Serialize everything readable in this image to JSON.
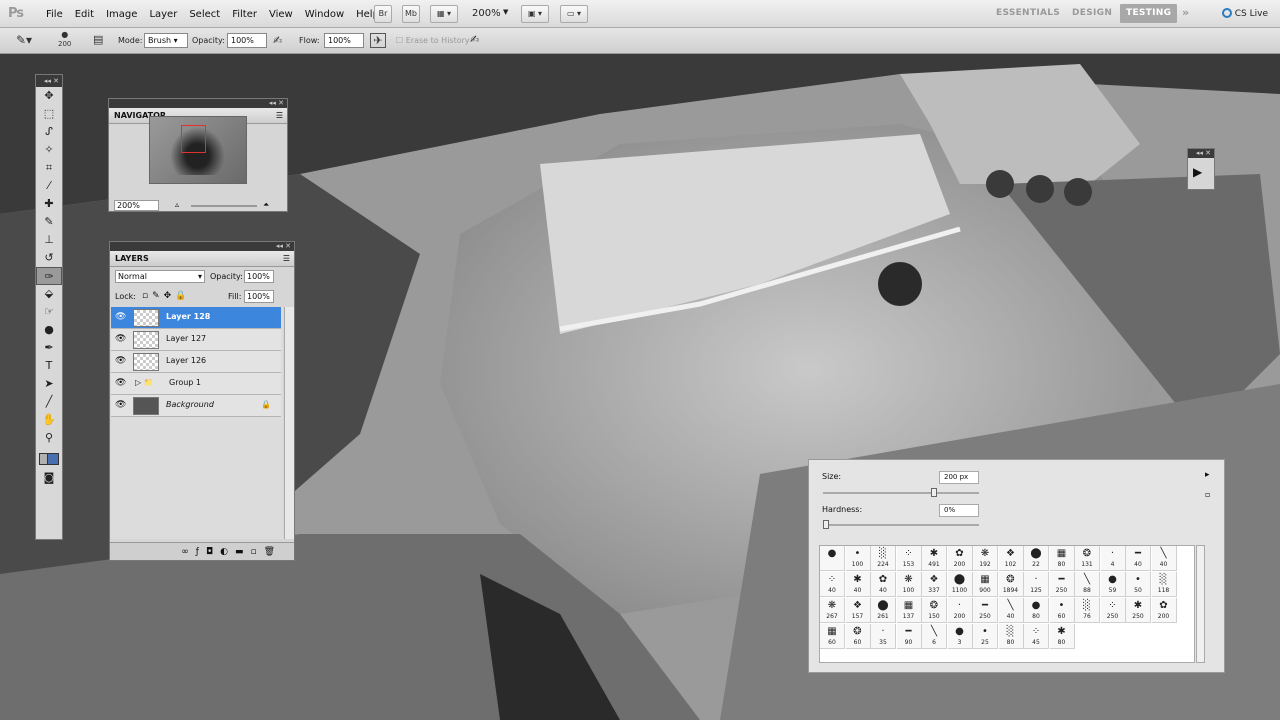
{
  "app": {
    "logo": "Ps"
  },
  "menubar": {
    "items": [
      "File",
      "Edit",
      "Image",
      "Layer",
      "Select",
      "Filter",
      "View",
      "Window",
      "Help"
    ],
    "bridge_btn": "Br",
    "minibridge_btn": "Mb",
    "zoom": "200%",
    "workspaces": [
      "ESSENTIALS",
      "DESIGN",
      "TESTING"
    ],
    "active_workspace": "TESTING",
    "cs_live": "CS Live"
  },
  "options": {
    "brush_size": "200",
    "mode_label": "Mode:",
    "mode_value": "Brush",
    "opacity_label": "Opacity:",
    "opacity_value": "100%",
    "flow_label": "Flow:",
    "flow_value": "100%",
    "erase_history": "Erase to History"
  },
  "navigator": {
    "title": "NAVIGATOR",
    "zoom": "200%"
  },
  "layers": {
    "title": "LAYERS",
    "blend_mode": "Normal",
    "opacity_label": "Opacity:",
    "opacity_value": "100%",
    "lock_label": "Lock:",
    "fill_label": "Fill:",
    "fill_value": "100%",
    "rows": [
      {
        "name": "Layer 128",
        "selected": true
      },
      {
        "name": "Layer 127"
      },
      {
        "name": "Layer 126"
      },
      {
        "name": "Group 1",
        "group": true
      },
      {
        "name": "Background",
        "locked": true
      }
    ]
  },
  "brush_picker": {
    "size_label": "Size:",
    "size_value": "200 px",
    "hardness_label": "Hardness:",
    "hardness_value": "0%",
    "size_fraction": 0.72,
    "hardness_fraction": 0.0,
    "brushes": [
      [
        "",
        "100",
        "224",
        "153",
        "491",
        "200",
        "192",
        "102",
        "22",
        "80",
        "131",
        "4",
        "40",
        "40"
      ],
      [
        "40",
        "40",
        "40",
        "100",
        "337",
        "1100",
        "900",
        "1894",
        "125",
        "250",
        "88",
        "59",
        "50",
        "118"
      ],
      [
        "267",
        "157",
        "261",
        "137",
        "150",
        "200",
        "250",
        "40",
        "80",
        "60",
        "76",
        "250",
        "250",
        "200"
      ],
      [
        "60",
        "60",
        "35",
        "90",
        "6",
        "3",
        "25",
        "80",
        "45",
        "80"
      ]
    ]
  },
  "colors": {
    "selection": "#3d86de",
    "panel_bg": "#d6d6d6",
    "chrome": "#3a3a3a"
  }
}
